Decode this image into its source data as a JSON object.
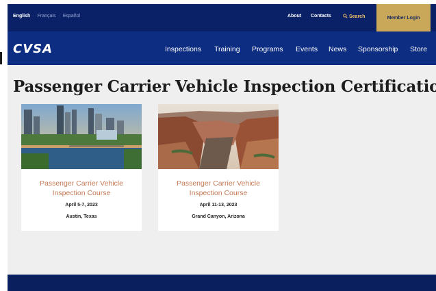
{
  "languages": [
    {
      "label": "English",
      "active": true
    },
    {
      "label": "Français",
      "active": false
    },
    {
      "label": "Español",
      "active": false
    }
  ],
  "utility_nav": {
    "about": "About",
    "contacts": "Contacts",
    "search": "Search",
    "member_login": "Member Login"
  },
  "logo": {
    "text": "CVSA"
  },
  "main_nav": [
    "Inspections",
    "Training",
    "Programs",
    "Events",
    "News",
    "Sponsorship",
    "Store"
  ],
  "page": {
    "title": "Passenger Carrier Vehicle Inspection Certification"
  },
  "cards": [
    {
      "title_line1": "Passenger Carrier Vehicle",
      "title_line2": "Inspection Course",
      "date": "April 5-7, 2023",
      "location": "Austin, Texas",
      "image": "city-skyline-river-photo"
    },
    {
      "title_line1": "Passenger Carrier Vehicle",
      "title_line2": "Inspection Course",
      "date": "April 11-13, 2023",
      "location": "Grand Canyon, Arizona",
      "image": "canyon-landscape-photo"
    }
  ],
  "colors": {
    "topbar": "#0a2168",
    "navbar": "#0d2d82",
    "member_button": "#c9a85a",
    "card_title": "#c47a55",
    "page_bg": "#efefef"
  }
}
